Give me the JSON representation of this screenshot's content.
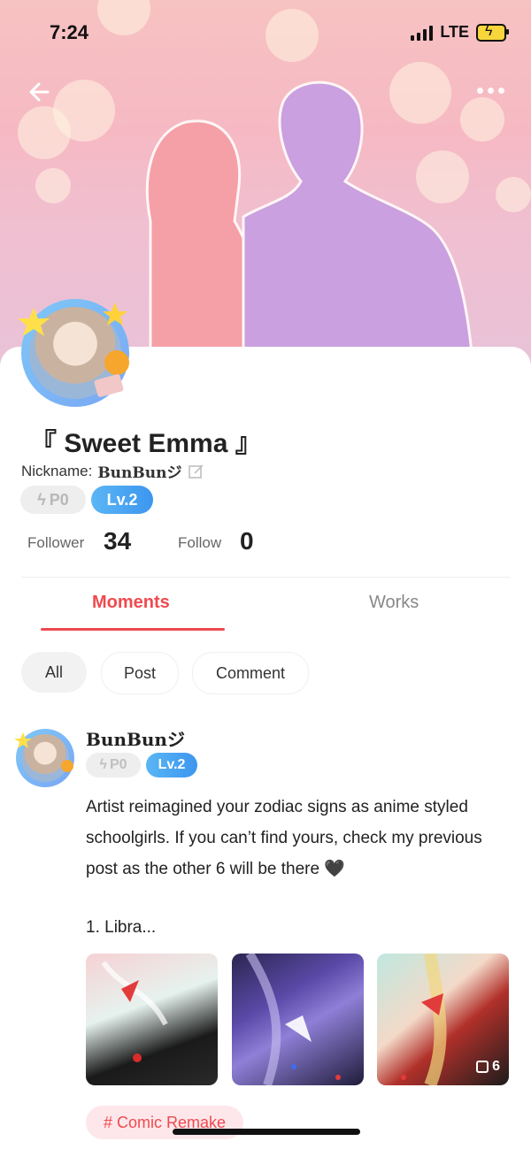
{
  "status_bar": {
    "time": "7:24",
    "network": "LTE"
  },
  "header": {
    "back_icon": "arrow-left-icon",
    "more_icon": "more-dots-icon"
  },
  "profile": {
    "title": "『 Sweet Emma 』",
    "nickname_label": "Nickname:",
    "nickname": "BunBunジ",
    "points_badge": "P0",
    "level_badge": "Lv.2",
    "follower_label": "Follower",
    "follower_count": "34",
    "follow_label": "Follow",
    "follow_count": "0"
  },
  "tabs": [
    {
      "label": "Moments",
      "active": true
    },
    {
      "label": "Works",
      "active": false
    }
  ],
  "filters": [
    {
      "label": "All",
      "selected": true
    },
    {
      "label": "Post",
      "selected": false
    },
    {
      "label": "Comment",
      "selected": false
    }
  ],
  "post": {
    "author": "BunBunジ",
    "points_badge": "P0",
    "level_badge": "Lv.2",
    "text": "Artist reimagined your zodiac signs as anime styled schoolgirls. If you can’t find yours, check my previous post as the other 6 will be there 🖤",
    "more_text": "1. Libra...",
    "image_count": "6",
    "hashtag": "# Comic Remake"
  },
  "colors": {
    "accent": "#ef4a4f",
    "level_badge": "#3d96ef",
    "avatar_ring": "#7aa6f4"
  }
}
